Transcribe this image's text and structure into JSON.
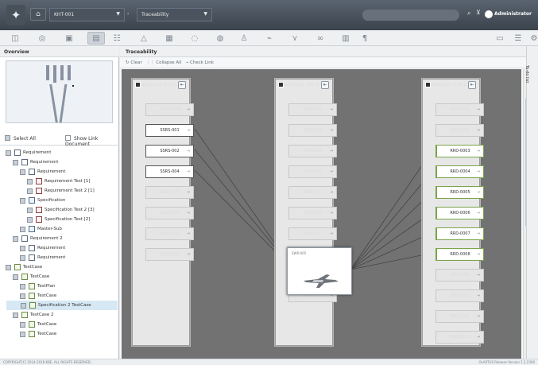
{
  "header": {
    "document": "KHT-001",
    "view": "Traceability",
    "user": "Administrator",
    "icons": [
      "logo-icon",
      "home-icon",
      "search-icon",
      "filter-icon",
      "user-status-icon"
    ]
  },
  "toolbar": {
    "icons": [
      "chart-icon",
      "compass-icon",
      "grid-icon",
      "layout-icon",
      "list-icon",
      "triangle-icon",
      "matrix-icon",
      "bubble-icon",
      "chat-icon",
      "person-icon",
      "network-icon",
      "branch-icon",
      "link-icon",
      "table-icon",
      "text-icon",
      "settings-icon",
      "tree-icon",
      "close-icon"
    ]
  },
  "overview": {
    "title": "Overview",
    "select_all": "Select All",
    "show_link_document": "Show Link Document"
  },
  "tree": {
    "items": [
      {
        "label": "Requirement",
        "level": 0,
        "kind": "req"
      },
      {
        "label": "Requirement",
        "level": 1,
        "kind": "req"
      },
      {
        "label": "Requirement",
        "level": 2,
        "kind": "req"
      },
      {
        "label": "Requirement Test [1]",
        "level": 3,
        "kind": "test"
      },
      {
        "label": "Requirement Test 2 [1]",
        "level": 3,
        "kind": "test"
      },
      {
        "label": "Specification",
        "level": 2,
        "kind": "spec"
      },
      {
        "label": "Specification Test 2 [3]",
        "level": 3,
        "kind": "test"
      },
      {
        "label": "Specification Test [2]",
        "level": 3,
        "kind": "test"
      },
      {
        "label": "Master-Sub",
        "level": 2,
        "kind": "spec"
      },
      {
        "label": "Requirement 2",
        "level": 1,
        "kind": "req"
      },
      {
        "label": "Requirement",
        "level": 2,
        "kind": "req"
      },
      {
        "label": "Requirement",
        "level": 2,
        "kind": "req"
      },
      {
        "label": "TestCase",
        "level": 0,
        "kind": "case"
      },
      {
        "label": "TestCase",
        "level": 1,
        "kind": "case"
      },
      {
        "label": "TestPlan",
        "level": 2,
        "kind": "case"
      },
      {
        "label": "TestCase",
        "level": 2,
        "kind": "case"
      },
      {
        "label": "Specification 2 TestCase",
        "level": 2,
        "kind": "case",
        "selected": true
      },
      {
        "label": "TestCase 2",
        "level": 1,
        "kind": "case"
      },
      {
        "label": "TestCase",
        "level": 2,
        "kind": "case"
      },
      {
        "label": "TestCase",
        "level": 2,
        "kind": "case"
      }
    ]
  },
  "traceability": {
    "title": "Traceability",
    "actions": {
      "clear": "Clear",
      "collapse": "Collapse All",
      "check": "Check Link"
    },
    "columns": [
      {
        "title": "Requirement Test 2",
        "nodes": [
          {
            "label": "_SSRS-9506",
            "active": false
          },
          {
            "label": "SSRS-001",
            "active": true
          },
          {
            "label": "SSRS-002",
            "active": true
          },
          {
            "label": "SSRS-004",
            "active": true
          },
          {
            "label": "SSRS-006",
            "active": false
          },
          {
            "label": "SSRS-007",
            "active": false
          },
          {
            "label": "SSRS-008",
            "active": false
          },
          {
            "label": "SSRS-009",
            "active": false
          }
        ]
      },
      {
        "title": "Specification Test 2",
        "nodes": [
          {
            "label": "SWR-001",
            "active": false
          },
          {
            "label": "SWR-002",
            "active": false
          },
          {
            "label": "SWR-003",
            "active": false
          },
          {
            "label": "SWR-004",
            "active": false
          },
          {
            "label": "SWR-005",
            "active": false
          },
          {
            "label": "SWR-006",
            "active": false
          },
          {
            "label": "SWR-007",
            "active": false
          },
          {
            "label": "SWR-008",
            "active": false
          },
          {
            "label": "SWR-009",
            "active": false
          },
          {
            "label": "SWR-010",
            "active": false
          }
        ]
      },
      {
        "title": "Specification 2 TestCase",
        "nodes": [
          {
            "label": "RRD-0001",
            "active": false
          },
          {
            "label": "RRD-0002",
            "active": false
          },
          {
            "label": "RRD-0003",
            "active": true
          },
          {
            "label": "RRD-0004",
            "active": true
          },
          {
            "label": "RRD-0005",
            "active": true
          },
          {
            "label": "RRD-0006",
            "active": true
          },
          {
            "label": "RRD-0007",
            "active": true
          },
          {
            "label": "RRD-0008",
            "active": true
          },
          {
            "label": "RRD-0009",
            "active": false
          },
          {
            "label": "RRD-0010",
            "active": false
          },
          {
            "label": "RRD-0011",
            "active": false
          },
          {
            "label": "RRD-0012",
            "active": false
          }
        ]
      }
    ],
    "featured": {
      "heading": "SWR-005"
    }
  },
  "side": {
    "label": "To-do list"
  },
  "status": {
    "left": "COPYRIGHT(C) 2014-2018 KBE. ALL RIGHTS RESERVED.",
    "right": "OLARTUS Release Version 1.2.2300"
  }
}
